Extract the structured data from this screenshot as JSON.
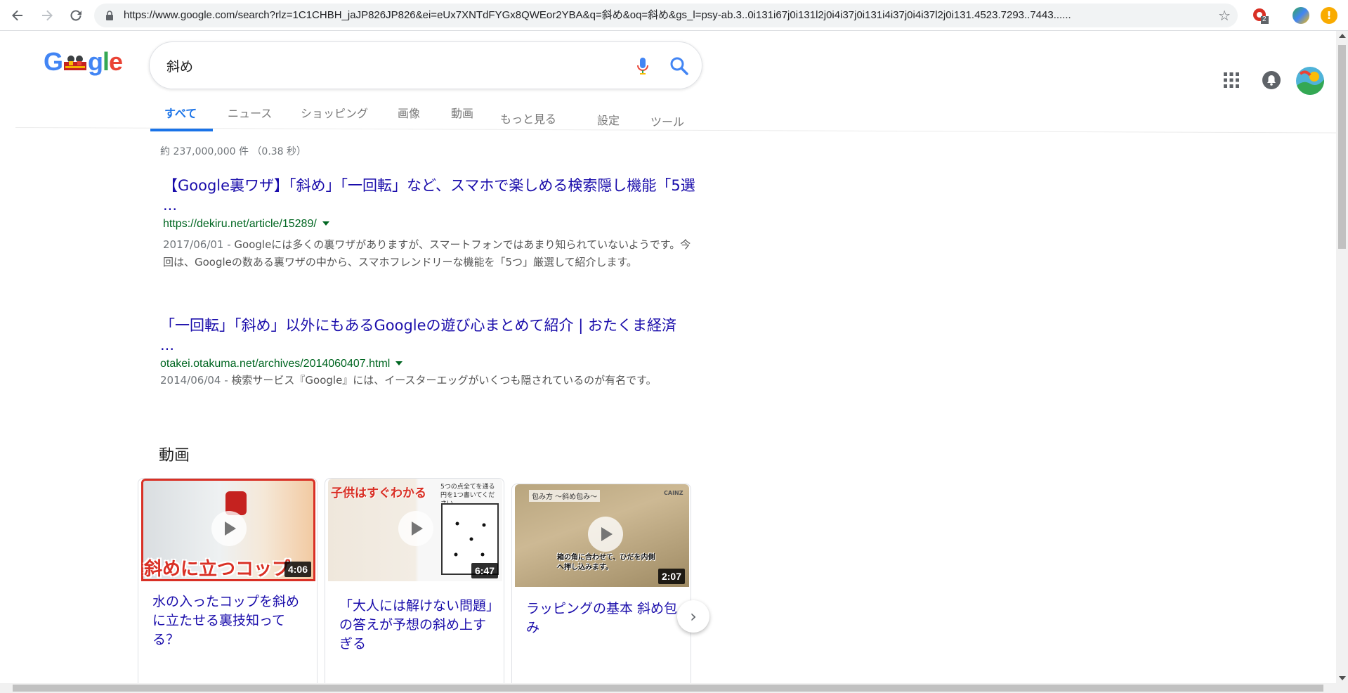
{
  "browser": {
    "url": "https://www.google.com/search?rlz=1C1CHBH_jaJP826JP826&ei=eUx7XNTdFYGx8QWEor2YBA&q=斜め&oq=斜め&gs_l=psy-ab.3..0i131i67j0i131l2j0i4i37j0i131i4i37j0i4i37l2j0i131.4523.7293..7443......",
    "back_icon": "back-arrow-icon",
    "forward_icon": "forward-arrow-icon",
    "reload_icon": "reload-icon",
    "extension_badge": "2"
  },
  "search": {
    "query": "斜め"
  },
  "tabs": [
    {
      "label": "すべて",
      "active": true
    },
    {
      "label": "ニュース"
    },
    {
      "label": "ショッピング"
    },
    {
      "label": "画像"
    },
    {
      "label": "動画"
    },
    {
      "label": "もっと見る"
    },
    {
      "label": "設定"
    },
    {
      "label": "ツール"
    }
  ],
  "result_stats": "約 237,000,000 件 （0.38 秒）",
  "results": [
    {
      "title": "【Google裏ワザ】「斜め」「一回転」など、スマホで楽しめる検索隠し機能「5選 ...",
      "url": "https://dekiru.net/article/15289/",
      "date": "2017/06/01 - ",
      "snippet": "Googleには多くの裏ワザがありますが、スマートフォンではあまり知られていないようです。今回は、Googleの数ある裏ワザの中から、スマホフレンドリーな機能を「5つ」厳選して紹介します。"
    },
    {
      "title": "「一回転」「斜め」以外にもあるGoogleの遊び心まとめて紹介 | おたくま経済 ...",
      "url": "otakei.otakuma.net/archives/2014060407.html",
      "date": "2014/06/04 - ",
      "snippet": "検索サービス『Google』には、イースターエッグがいくつも隠されているのが有名です。"
    }
  ],
  "videos": {
    "heading": "動画",
    "items": [
      {
        "title": "水の入ったコップを斜めに立たせる裏技知ってる？",
        "duration": "4:06",
        "thumb_caption": "斜めに立つコップ"
      },
      {
        "title": "「大人には解けない問題」の答えが予想の斜め上すぎる",
        "duration": "6:47",
        "thumb_caption": "子供はすぐわかる",
        "thumb_note": "5つの点全てを通る円を1つ書いてください。"
      },
      {
        "title": "ラッピングの基本 斜め包み",
        "duration": "2:07",
        "thumb_caption": "包み方 〜斜め包み〜",
        "thumb_note": "箱の角に合わせて、ひだを内側へ押し込みます。",
        "thumb_brand": "CAINZ"
      }
    ]
  },
  "colors": {
    "link": "#1a0dab",
    "url_green": "#006621",
    "tab_active": "#1a73e8"
  }
}
